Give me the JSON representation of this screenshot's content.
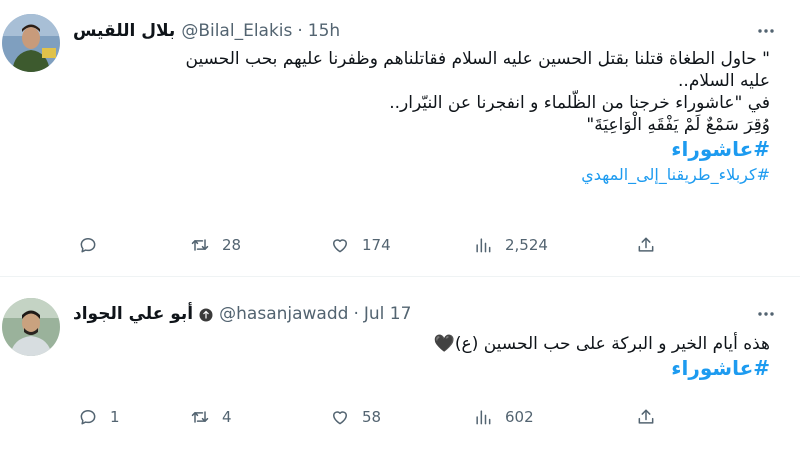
{
  "tweets": [
    {
      "display_name": "بلال اللقيس",
      "handle": "@Bilal_Elakis",
      "separator": "·",
      "time": "15h",
      "body_lines": [
        "\" حاول الطغاة قتلنا بقتل الحسين عليه السلام فقاتلناهم وظفرنا عليهم بحب الحسين",
        "عليه السلام..",
        "في \"عاشوراء خرجنا من الظّلماء و انفجرنا عن النيّرار..",
        "وُقِرَ سَمْعٌ لَمْ يَفْقَهِ الْوَاعِيَةَ\""
      ],
      "hashtag_main": "#عاشوراء",
      "hashtag_secondary": "#كربلاء_طريقنا_إلى_المهدي",
      "replies": "",
      "retweets": "28",
      "likes": "174",
      "views": "2,524",
      "avatar_colors": {
        "bg": "#6b8fb3",
        "skin": "#c89b7b",
        "shirt": "#3d5a2e"
      }
    },
    {
      "display_name": "أبو علي الجواد",
      "handle": "@hasanjawadd",
      "separator": "·",
      "time": "Jul 17",
      "body_text": "هذه أيام الخير و البركة على حب الحسين (ع)",
      "heart": "🖤",
      "hashtag_main": "#عاشوراء",
      "replies": "1",
      "retweets": "4",
      "likes": "58",
      "views": "602",
      "avatar_colors": {
        "bg": "#8aa38b",
        "skin": "#c9a27f",
        "shirt": "#d7dde0"
      }
    }
  ],
  "icons": {
    "reply": "reply-icon",
    "retweet": "retweet-icon",
    "like": "like-icon",
    "views": "views-icon",
    "share": "share-icon",
    "more": "more-icon"
  },
  "colors": {
    "hashtag": "#1d9bf0",
    "meta": "#536471",
    "text": "#0f1419"
  }
}
